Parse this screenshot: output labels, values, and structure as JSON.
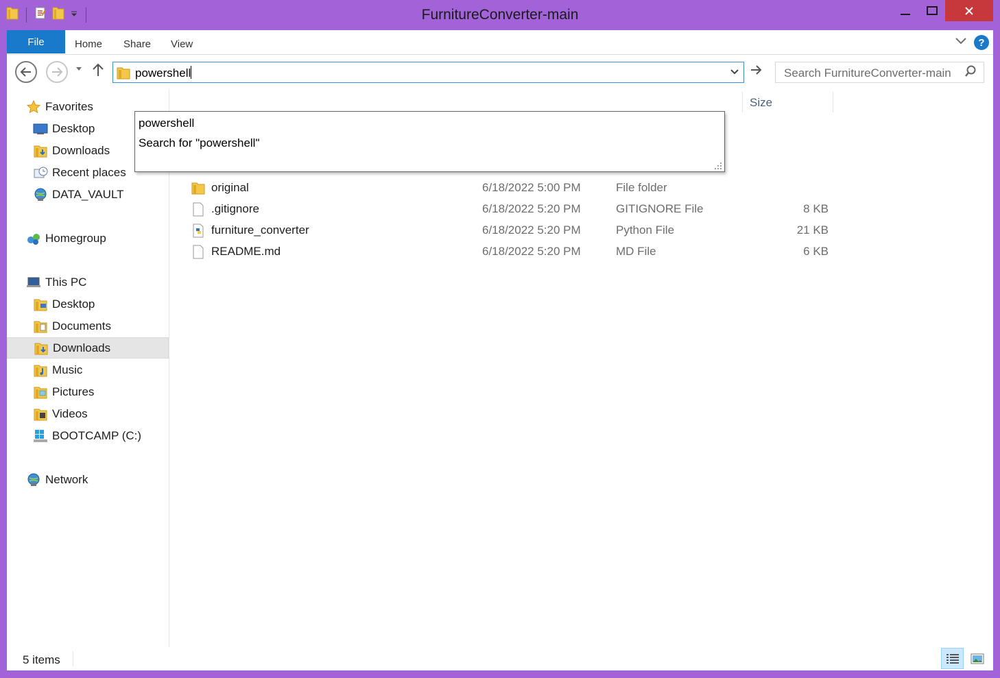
{
  "window": {
    "title": "FurnitureConverter-main"
  },
  "ribbon": {
    "file_label": "File",
    "tabs": [
      "Home",
      "Share",
      "View"
    ],
    "help_label": "?"
  },
  "navbar": {
    "address_value": "powershell",
    "search_placeholder": "Search FurnitureConverter-main"
  },
  "autocomplete": {
    "items": [
      "powershell",
      "Search for \"powershell\""
    ]
  },
  "sidebar": {
    "favorites": {
      "label": "Favorites",
      "items": [
        "Desktop",
        "Downloads",
        "Recent places",
        "DATA_VAULT"
      ]
    },
    "homegroup": {
      "label": "Homegroup"
    },
    "this_pc": {
      "label": "This PC",
      "items": [
        "Desktop",
        "Documents",
        "Downloads",
        "Music",
        "Pictures",
        "Videos",
        "BOOTCAMP (C:)"
      ]
    },
    "network": {
      "label": "Network"
    },
    "selected": "Downloads"
  },
  "filelist": {
    "columns": {
      "size": "Size"
    },
    "rows": [
      {
        "name": "original",
        "date": "6/18/2022 5:00 PM",
        "type": "File folder",
        "size": "",
        "icon": "folder-icon"
      },
      {
        "name": ".gitignore",
        "date": "6/18/2022 5:20 PM",
        "type": "GITIGNORE File",
        "size": "8 KB",
        "icon": "file-icon"
      },
      {
        "name": "furniture_converter",
        "date": "6/18/2022 5:20 PM",
        "type": "Python File",
        "size": "21 KB",
        "icon": "python-file-icon"
      },
      {
        "name": "README.md",
        "date": "6/18/2022 5:20 PM",
        "type": "MD File",
        "size": "6 KB",
        "icon": "file-icon"
      }
    ]
  },
  "statusbar": {
    "item_count": "5 items"
  },
  "colors": {
    "window_frame": "#a263d9",
    "file_tab": "#1979ca",
    "close_button": "#c7383c",
    "address_border": "#3c8fd9",
    "selection": "#e5e5e5"
  }
}
